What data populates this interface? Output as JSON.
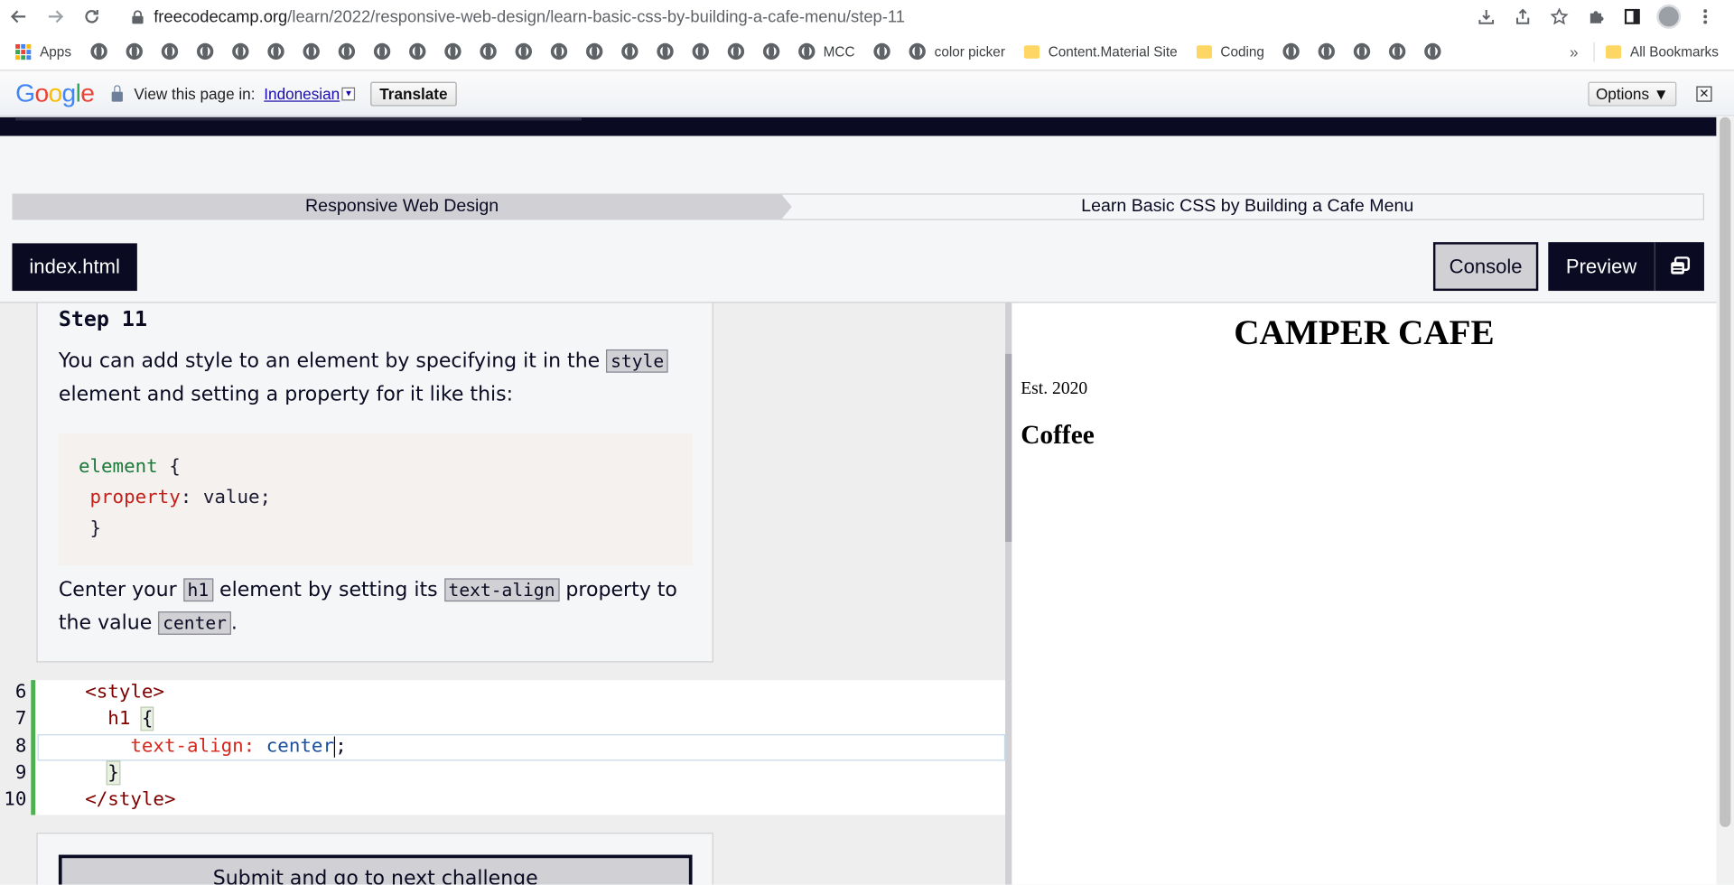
{
  "browser": {
    "url_host": "freecodecamp.org",
    "url_path": "/learn/2022/responsive-web-design/learn-basic-css-by-building-a-cafe-menu/step-11"
  },
  "bookmarks": {
    "apps_label": "Apps",
    "items": [
      "MCC",
      "color picker",
      "Content.Material Site",
      "Coding"
    ],
    "all_bookmarks": "All Bookmarks",
    "overflow": "»"
  },
  "translate_bar": {
    "logo": [
      "G",
      "o",
      "o",
      "g",
      "l",
      "e"
    ],
    "view_label": "View this page in:",
    "language": "Indonesian",
    "translate_button": "Translate",
    "options_button": "Options ▼",
    "close": "✕"
  },
  "breadcrumb": {
    "course": "Responsive Web Design",
    "project": "Learn Basic CSS by Building a Cafe Menu"
  },
  "tabs": {
    "file": "index.html",
    "console": "Console",
    "preview": "Preview"
  },
  "instructions": {
    "step_title": "Step 11",
    "p1_a": "You can add style to an element by specifying it in the ",
    "p1_code": "style",
    "p1_b": " element and setting a property for it like this:",
    "code_line1_el": "element",
    "code_line1_brace": " {",
    "code_line2_prop": "property",
    "code_line2_colon": ": ",
    "code_line2_val": "value;",
    "code_line3": "}",
    "p2_a": "Center your ",
    "p2_code1": "h1",
    "p2_b": " element by setting its ",
    "p2_code2": "text-align",
    "p2_c": " property to the value ",
    "p2_code3": "center",
    "p2_d": "."
  },
  "editor": {
    "line_numbers": [
      "6",
      "7",
      "8",
      "9",
      "10"
    ],
    "line6": "<style>",
    "line7_sel": "h1",
    "line7_brace": "{",
    "line8_prop": "text-align:",
    "line8_val": "center",
    "line8_end": ";",
    "line9": "}",
    "line10": "</style>"
  },
  "submit_button": "Submit and go to next challenge",
  "preview": {
    "h1": "CAMPER CAFE",
    "p": "Est. 2020",
    "h2": "Coffee"
  },
  "colors": {
    "fcc_dark": "#0a0a23",
    "fcc_gray": "#d0d0d5",
    "gutter_green": "#4caf50"
  }
}
